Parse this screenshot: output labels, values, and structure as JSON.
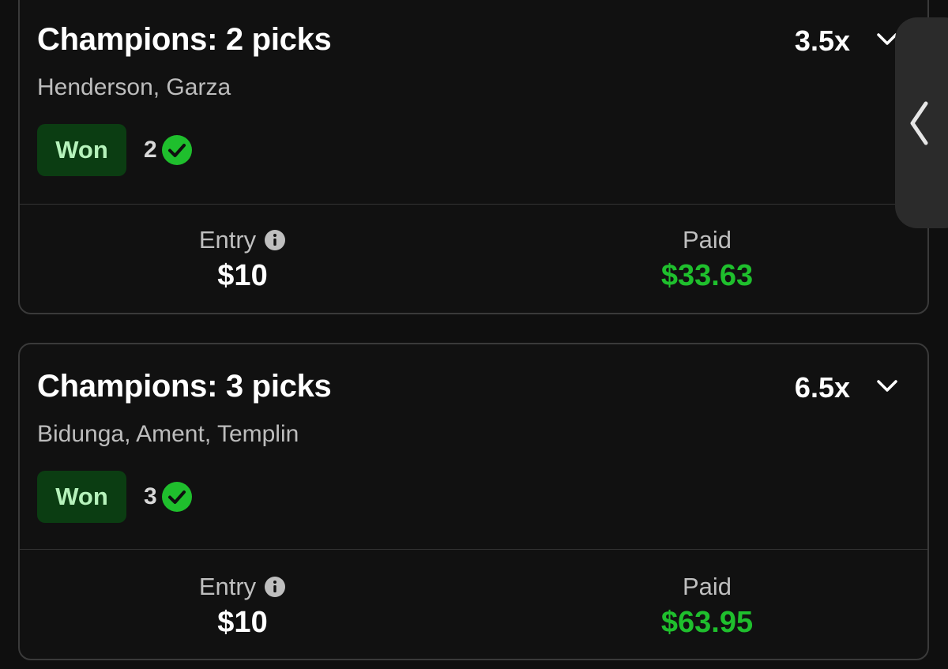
{
  "entries": [
    {
      "title": "Champions: 2 picks",
      "multiplier": "3.5x",
      "players": "Henderson, Garza",
      "status": "Won",
      "correct_count": "2",
      "entry_label": "Entry",
      "entry_value": "$10",
      "paid_label": "Paid",
      "paid_value": "$33.63"
    },
    {
      "title": "Champions: 3 picks",
      "multiplier": "6.5x",
      "players": "Bidunga, Ament, Templin",
      "status": "Won",
      "correct_count": "3",
      "entry_label": "Entry",
      "entry_value": "$10",
      "paid_label": "Paid",
      "paid_value": "$63.95"
    }
  ],
  "icons": {
    "expand": "chevron-down-icon",
    "check": "check-circle-icon",
    "info": "info-icon",
    "side_handle": "chevron-left-icon"
  },
  "colors": {
    "background": "#0f0f0f",
    "won_badge_bg": "#0b3d12",
    "won_badge_text": "#b6f2bb",
    "paid_green": "#1fbf2d",
    "check_green": "#1fbf2d"
  }
}
